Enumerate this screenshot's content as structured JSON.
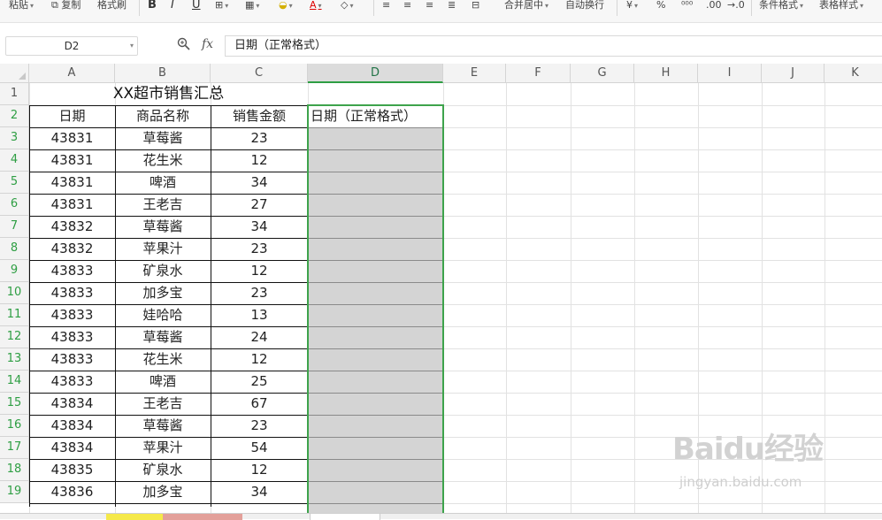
{
  "ribbon": {
    "items": [
      "粘贴",
      "复制",
      "格式刷",
      "B",
      "I",
      "U",
      "合并居中",
      "自动换行",
      "%",
      ".00",
      "条件格式",
      "表格样式"
    ]
  },
  "formula_bar": {
    "name_box": "D2",
    "fx_label": "fx",
    "content": "日期（正常格式）"
  },
  "columns": [
    "A",
    "B",
    "C",
    "D",
    "E",
    "F",
    "G",
    "H",
    "I",
    "J",
    "K"
  ],
  "selected_column": "D",
  "rows": [
    "1",
    "2",
    "3",
    "4",
    "5",
    "6",
    "7",
    "8",
    "9",
    "10",
    "11",
    "12",
    "13",
    "14",
    "15",
    "16",
    "17",
    "18",
    "19"
  ],
  "sheet": {
    "title": "XX超市销售汇总",
    "headers": [
      "日期",
      "商品名称",
      "销售金额",
      "日期（正常格式）"
    ],
    "data": [
      [
        "43831",
        "草莓酱",
        "23"
      ],
      [
        "43831",
        "花生米",
        "12"
      ],
      [
        "43831",
        "啤酒",
        "34"
      ],
      [
        "43831",
        "王老吉",
        "27"
      ],
      [
        "43832",
        "草莓酱",
        "34"
      ],
      [
        "43832",
        "苹果汁",
        "23"
      ],
      [
        "43833",
        "矿泉水",
        "12"
      ],
      [
        "43833",
        "加多宝",
        "23"
      ],
      [
        "43833",
        "娃哈哈",
        "13"
      ],
      [
        "43833",
        "草莓酱",
        "24"
      ],
      [
        "43833",
        "花生米",
        "12"
      ],
      [
        "43833",
        "啤酒",
        "25"
      ],
      [
        "43834",
        "王老吉",
        "67"
      ],
      [
        "43834",
        "草莓酱",
        "23"
      ],
      [
        "43834",
        "苹果汁",
        "54"
      ],
      [
        "43835",
        "矿泉水",
        "12"
      ],
      [
        "43836",
        "加多宝",
        "34"
      ]
    ]
  },
  "watermark": {
    "brand": "Baidu经验",
    "url": "jingyan.baidu.com"
  },
  "colors": {
    "selection": "#3ea34c",
    "selected_fill": "#d4d4d4",
    "header_bg": "#f3f3f3"
  }
}
